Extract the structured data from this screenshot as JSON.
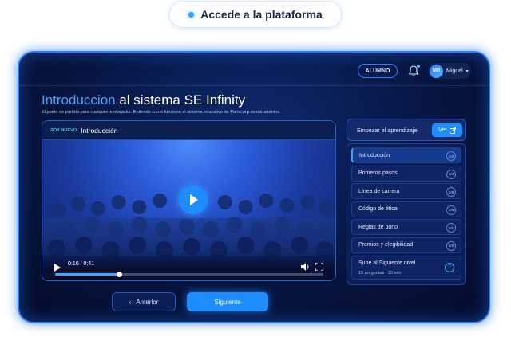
{
  "banner": {
    "label": "Accede a la plataforma"
  },
  "topbar": {
    "role": "ALUMNO",
    "user": {
      "initials": "MR",
      "name": "Miguel"
    }
  },
  "page": {
    "title_highlight": "Introduccion",
    "title_rest": " al sistema SE Infinity",
    "subtitle": "El punto de partida para cualquier embajador. Entiende como funciona el sistema educativo de Pariscorp desde adentro."
  },
  "video": {
    "tag": "SOY NUEVO",
    "title": "Introducción",
    "time": "0:10 / 0:41",
    "progress_fraction": 0.24
  },
  "sidebar": {
    "header_label": "Empezar el aprendizaje",
    "view_button": "Ver",
    "items": [
      {
        "label": "Introducción",
        "badge": "2/4"
      },
      {
        "label": "Primeros pasos",
        "badge": "0/4"
      },
      {
        "label": "Línea de carrera",
        "badge": "0/8"
      },
      {
        "label": "Código de ética",
        "badge": "0/5"
      },
      {
        "label": "Reglas de bono",
        "badge": "0/1"
      },
      {
        "label": "Premios y elegibilidad",
        "badge": "0/2"
      }
    ],
    "level": {
      "title": "Sube al Siguiente nivel",
      "subtitle": "15 preguntas - 20 min"
    }
  },
  "nav": {
    "prev": "Anterior",
    "next": "Siguiente"
  },
  "colors": {
    "accent": "#1e8dff",
    "highlight": "#3ba7ff",
    "tag": "#2ec8e8"
  }
}
